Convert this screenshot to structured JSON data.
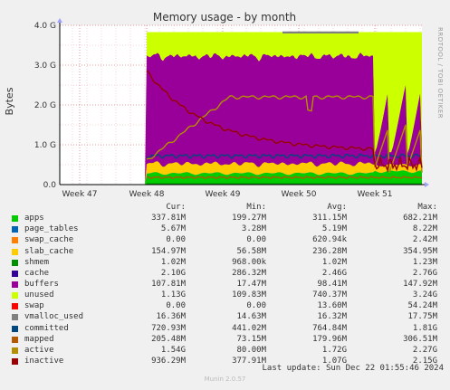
{
  "chart_data": {
    "type": "area",
    "title": "Memory usage - by month",
    "ylabel": "Bytes",
    "ylim": [
      0,
      4.0
    ],
    "yunit": "G",
    "yticks": [
      "0.0",
      "1.0 G",
      "2.0 G",
      "3.0 G",
      "4.0 G"
    ],
    "xticks": [
      "Week 47",
      "Week 48",
      "Week 49",
      "Week 50",
      "Week 51"
    ],
    "grid": true,
    "side_label": "RRDTOOL / TOBI OETIKER",
    "series_meta": [
      {
        "name": "apps",
        "color": "#00cc00"
      },
      {
        "name": "page_tables",
        "color": "#0066b3"
      },
      {
        "name": "swap_cache",
        "color": "#ff8000"
      },
      {
        "name": "slab_cache",
        "color": "#ffcc00"
      },
      {
        "name": "shmem",
        "color": "#330099"
      },
      {
        "name": "cache",
        "color": "#990099"
      },
      {
        "name": "buffers",
        "color": "#ccff00"
      },
      {
        "name": "unused",
        "color": "#ff0000"
      },
      {
        "name": "swap",
        "color": "#808080"
      },
      {
        "name": "vmalloc_used",
        "color": "#008f00"
      },
      {
        "name": "committed",
        "color": "#00487d"
      },
      {
        "name": "mapped",
        "color": "#b35a00"
      },
      {
        "name": "active",
        "color": "#b38f00"
      },
      {
        "name": "inactive",
        "color": "#6b006b"
      }
    ]
  },
  "legend": {
    "headers": {
      "cur": "Cur:",
      "min": "Min:",
      "avg": "Avg:",
      "max": "Max:"
    },
    "rows": [
      {
        "name": "apps",
        "color": "#00cc00",
        "cur": "337.81M",
        "min": "199.27M",
        "avg": "311.15M",
        "max": "682.21M"
      },
      {
        "name": "page_tables",
        "color": "#0066b3",
        "cur": "5.67M",
        "min": "3.28M",
        "avg": "5.19M",
        "max": "8.22M"
      },
      {
        "name": "swap_cache",
        "color": "#ff8000",
        "cur": "0.00",
        "min": "0.00",
        "avg": "620.94k",
        "max": "2.42M"
      },
      {
        "name": "slab_cache",
        "color": "#ffcc00",
        "cur": "154.97M",
        "min": "56.58M",
        "avg": "236.28M",
        "max": "354.95M"
      },
      {
        "name": "shmem",
        "color": "#008f00",
        "cur": "1.02M",
        "min": "968.00k",
        "avg": "1.02M",
        "max": "1.23M"
      },
      {
        "name": "cache",
        "color": "#330099",
        "cur": "2.10G",
        "min": "286.32M",
        "avg": "2.46G",
        "max": "2.76G"
      },
      {
        "name": "buffers",
        "color": "#990099",
        "cur": "107.81M",
        "min": "17.47M",
        "avg": "98.41M",
        "max": "147.92M"
      },
      {
        "name": "unused",
        "color": "#ccff00",
        "cur": "1.13G",
        "min": "109.83M",
        "avg": "740.37M",
        "max": "3.24G"
      },
      {
        "name": "swap",
        "color": "#ff0000",
        "cur": "0.00",
        "min": "0.00",
        "avg": "13.60M",
        "max": "54.24M"
      },
      {
        "name": "vmalloc_used",
        "color": "#808080",
        "cur": "16.36M",
        "min": "14.63M",
        "avg": "16.32M",
        "max": "17.75M"
      },
      {
        "name": "committed",
        "color": "#00487d",
        "cur": "720.93M",
        "min": "441.02M",
        "avg": "764.84M",
        "max": "1.81G"
      },
      {
        "name": "mapped",
        "color": "#b35a00",
        "cur": "205.48M",
        "min": "73.15M",
        "avg": "179.96M",
        "max": "306.51M"
      },
      {
        "name": "active",
        "color": "#b38f00",
        "cur": "1.54G",
        "min": "80.00M",
        "avg": "1.72G",
        "max": "2.27G"
      },
      {
        "name": "inactive",
        "color": "#990000",
        "cur": "936.29M",
        "min": "377.91M",
        "avg": "1.07G",
        "max": "2.15G"
      }
    ]
  },
  "last_update": "Last update: Sun Dec 22 01:55:46 2024",
  "munin_version": "Munin 2.0.57"
}
